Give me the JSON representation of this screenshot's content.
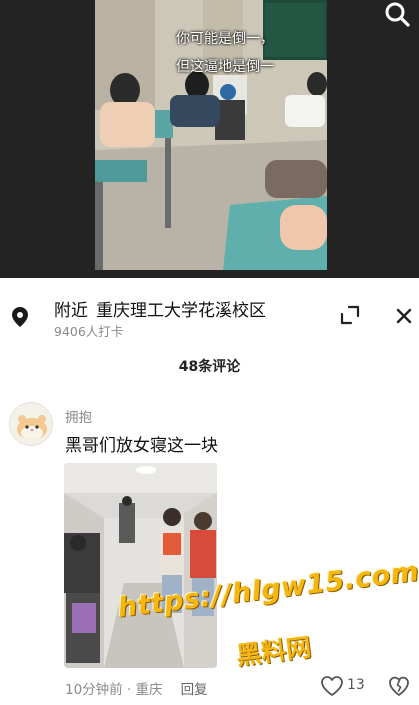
{
  "video": {
    "subtitle_line1": "你可能是倒一，",
    "subtitle_line2": "但这逼地是倒一"
  },
  "location": {
    "prefix": "附近",
    "name": "重庆理工大学花溪校区",
    "checkins": "9406人打卡"
  },
  "comments_header": "48条评论",
  "comment": {
    "username": "拥抱",
    "text": "黑哥们放女寝这一块",
    "time_place": "10分钟前 · 重庆",
    "reply_label": "回复",
    "likes": "13"
  },
  "watermark": {
    "url": "https://hlgw15.com",
    "name": "黑料网"
  },
  "colors": {
    "accent_watermark": "#f5b60f",
    "muted_text": "#8a8a8a",
    "video_bg": "#232323"
  },
  "icons": [
    "search-icon",
    "location-pin-icon",
    "minimize-icon",
    "close-icon",
    "heart-icon",
    "dislike-heart-icon"
  ]
}
